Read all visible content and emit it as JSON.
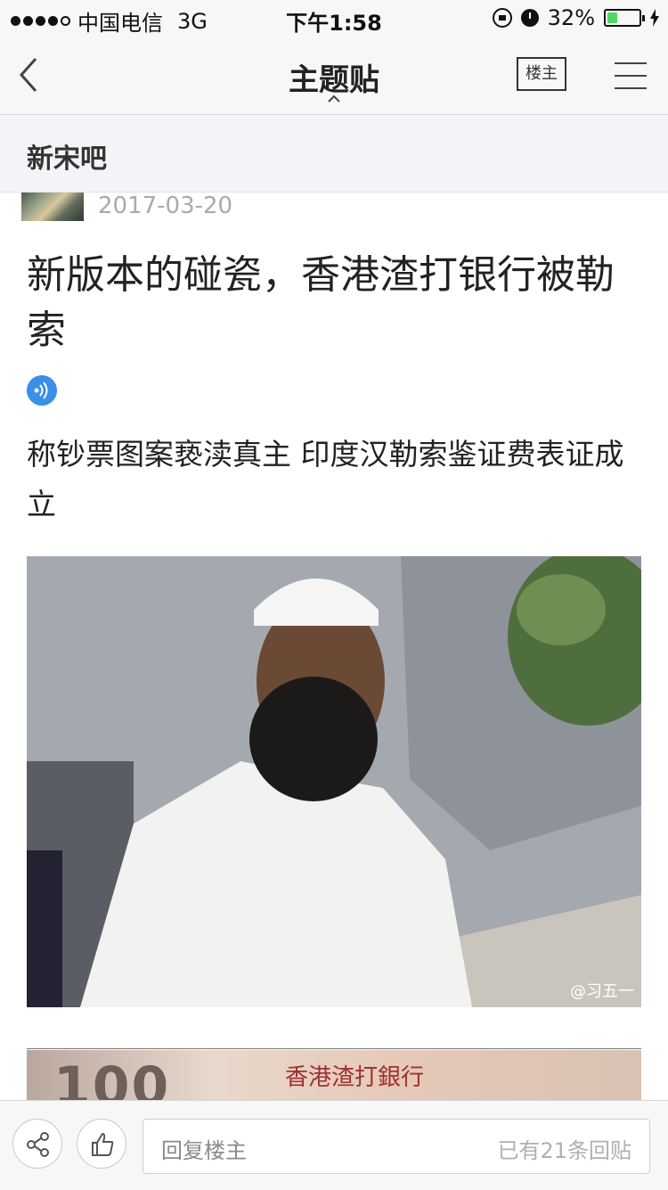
{
  "status_bar": {
    "carrier": "中国电信",
    "network": "3G",
    "time": "下午1:58",
    "battery_percent_text": "32%",
    "battery_level": 0.32,
    "signal_bars": 4
  },
  "nav": {
    "title": "主题贴",
    "louzhu_label": "楼主"
  },
  "forum": {
    "name": "新宋吧"
  },
  "post": {
    "date": "2017-03-20",
    "title": "新版本的碰瓷，香港渣打银行被勒索",
    "body": "称钞票图案亵渎真主 印度汉勒索鉴证费表证成立",
    "image_watermark": "@习五一",
    "banknote_number": "100",
    "banknote_bank": "香港渣打銀行"
  },
  "bottom_bar": {
    "reply_placeholder": "回复楼主",
    "reply_count": "已有21条回贴"
  },
  "colors": {
    "accent_blue": "#3a8fe8",
    "battery_green": "#4cd964",
    "date_gray": "#aaaaaa"
  },
  "icons": [
    "back-icon",
    "menu-icon",
    "audio-icon",
    "share-icon",
    "thumbs-up-icon",
    "lock-rotation-icon",
    "alarm-icon",
    "battery-icon",
    "charging-bolt-icon"
  ]
}
